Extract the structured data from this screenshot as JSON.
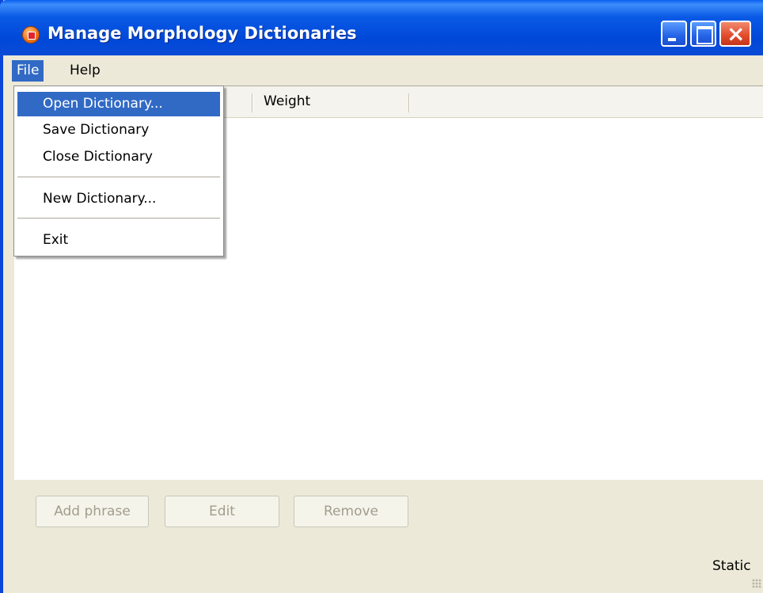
{
  "window": {
    "title": "Manage Morphology Dictionaries"
  },
  "menubar": {
    "items": [
      {
        "label": "File",
        "active": true
      },
      {
        "label": "Help",
        "active": false
      }
    ]
  },
  "file_menu": {
    "items": [
      {
        "label": "Open Dictionary...",
        "highlighted": true
      },
      {
        "label": "Save Dictionary"
      },
      {
        "label": "Close Dictionary"
      },
      {
        "label": "New Dictionary..."
      },
      {
        "label": "Exit"
      }
    ]
  },
  "listview": {
    "columns": [
      "Weight"
    ]
  },
  "buttons": {
    "add_phrase": "Add phrase",
    "edit": "Edit",
    "remove": "Remove"
  },
  "status": {
    "text": "Static"
  },
  "colors": {
    "titlebar": "#0a5ae6",
    "menu_highlight": "#316ac5",
    "window_bg": "#ece9d8"
  }
}
